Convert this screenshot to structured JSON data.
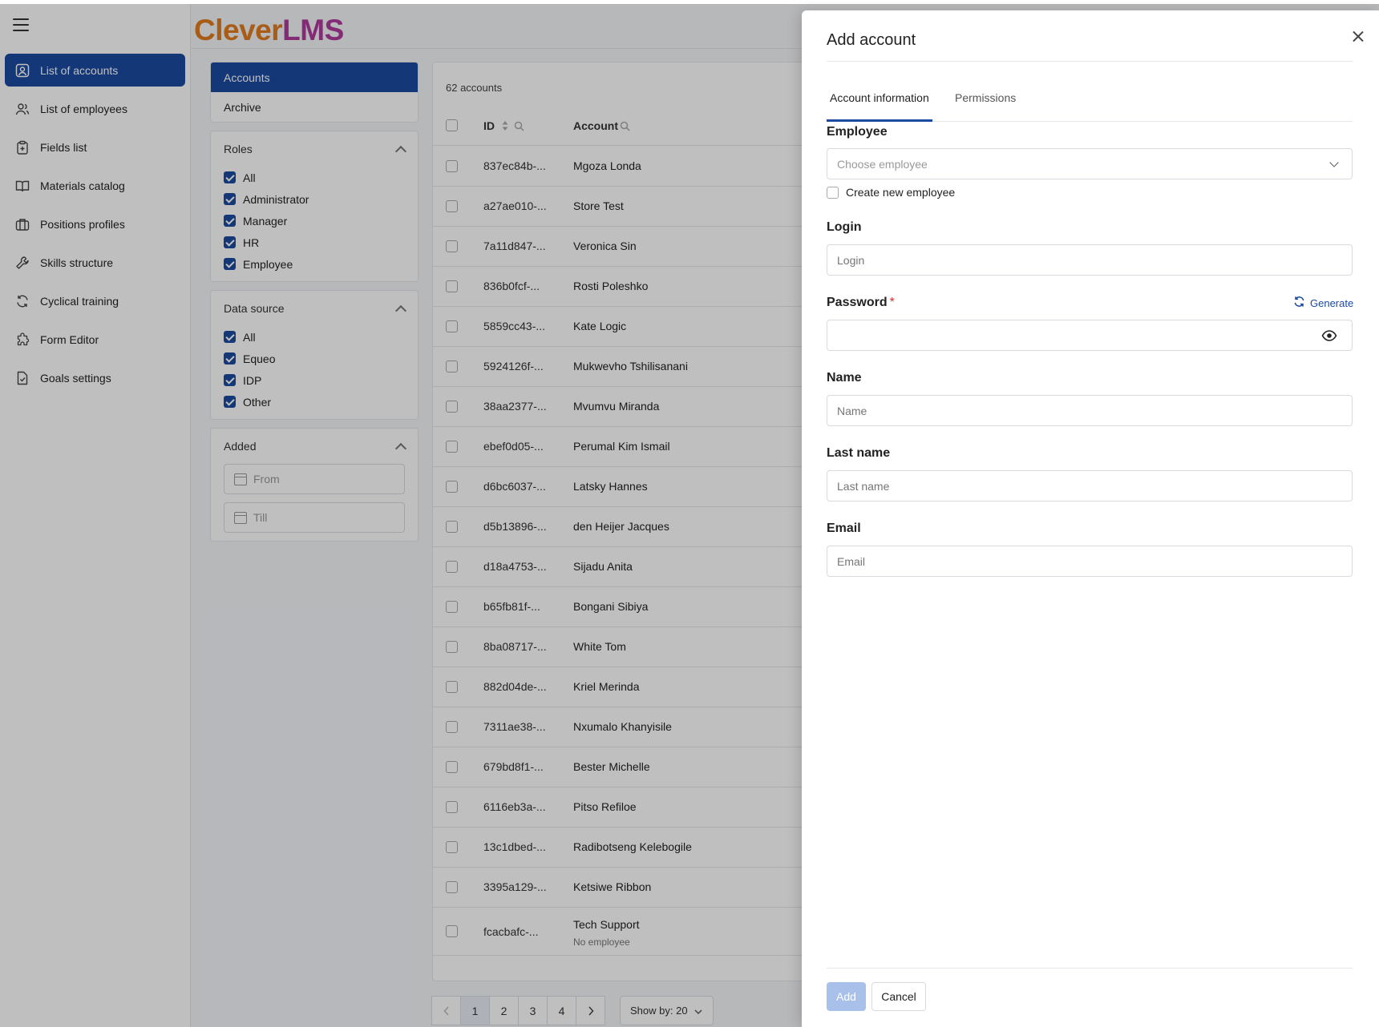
{
  "app": {
    "logo_part1": "Clever",
    "logo_part2": "LMS"
  },
  "sidebar": {
    "items": [
      {
        "label": "List of accounts",
        "icon": "account-icon",
        "active": true
      },
      {
        "label": "List of employees",
        "icon": "users-icon"
      },
      {
        "label": "Fields list",
        "icon": "clipboard-icon"
      },
      {
        "label": "Materials catalog",
        "icon": "book-icon"
      },
      {
        "label": "Positions profiles",
        "icon": "briefcase-icon"
      },
      {
        "label": "Skills structure",
        "icon": "wrench-icon"
      },
      {
        "label": "Cyclical training",
        "icon": "refresh-icon"
      },
      {
        "label": "Form Editor",
        "icon": "puzzle-icon"
      },
      {
        "label": "Goals settings",
        "icon": "document-icon"
      }
    ]
  },
  "filters": {
    "tabs": [
      "Accounts",
      "Archive"
    ],
    "roles": {
      "title": "Roles",
      "options": [
        "All",
        "Administrator",
        "Manager",
        "HR",
        "Employee"
      ]
    },
    "data_source": {
      "title": "Data source",
      "options": [
        "All",
        "Equeo",
        "IDP",
        "Other"
      ]
    },
    "added": {
      "title": "Added",
      "from_placeholder": "From",
      "till_placeholder": "Till"
    }
  },
  "table": {
    "count": "62 accounts",
    "columns": {
      "id": "ID",
      "account": "Account"
    },
    "rows": [
      {
        "id": "837ec84b-...",
        "name": "Mgoza Londa"
      },
      {
        "id": "a27ae010-...",
        "name": "Store Test"
      },
      {
        "id": "7a11d847-...",
        "name": "Veronica Sin"
      },
      {
        "id": "836b0fcf-...",
        "name": "Rosti Poleshko"
      },
      {
        "id": "5859cc43-...",
        "name": "Kate Logic"
      },
      {
        "id": "5924126f-...",
        "name": "Mukwevho Tshilisanani"
      },
      {
        "id": "38aa2377-...",
        "name": "Mvumvu Miranda"
      },
      {
        "id": "ebef0d05-...",
        "name": "Perumal Kim Ismail"
      },
      {
        "id": "d6bc6037-...",
        "name": "Latsky Hannes"
      },
      {
        "id": "d5b13896-...",
        "name": "den Heijer Jacques"
      },
      {
        "id": "d18a4753-...",
        "name": "Sijadu Anita"
      },
      {
        "id": "b65fb81f-...",
        "name": "Bongani Sibiya"
      },
      {
        "id": "8ba08717-...",
        "name": "White Tom"
      },
      {
        "id": "882d04de-...",
        "name": "Kriel Merinda"
      },
      {
        "id": "7311ae38-...",
        "name": "Nxumalo Khanyisile"
      },
      {
        "id": "679bd8f1-...",
        "name": "Bester Michelle"
      },
      {
        "id": "6116eb3a-...",
        "name": "Pitso Refiloe"
      },
      {
        "id": "13c1dbed-...",
        "name": "Radibotseng Kelebogile"
      },
      {
        "id": "3395a129-...",
        "name": "Ketsiwe Ribbon"
      },
      {
        "id": "fcacbafc-...",
        "name": "Tech Support",
        "sub": "No employee"
      }
    ]
  },
  "pagination": {
    "pages": [
      "1",
      "2",
      "3",
      "4"
    ],
    "current": "1",
    "show_by": "Show by: 20"
  },
  "drawer": {
    "title": "Add account",
    "tabs": [
      "Account information",
      "Permissions"
    ],
    "employee": {
      "label": "Employee",
      "placeholder": "Choose employee"
    },
    "create_new_employee": "Create new employee",
    "login": {
      "label": "Login",
      "placeholder": "Login"
    },
    "password": {
      "label": "Password",
      "required_mark": "*",
      "generate": "Generate"
    },
    "name": {
      "label": "Name",
      "placeholder": "Name"
    },
    "last_name": {
      "label": "Last name",
      "placeholder": "Last name"
    },
    "email": {
      "label": "Email",
      "placeholder": "Email"
    },
    "add_button": "Add",
    "cancel_button": "Cancel"
  },
  "colors": {
    "primary": "#1b4aa0",
    "logo_orange": "#e07b1e",
    "logo_purple": "#b03a9c",
    "required": "#d32f2f",
    "add_disabled": "#a9c1ea"
  }
}
